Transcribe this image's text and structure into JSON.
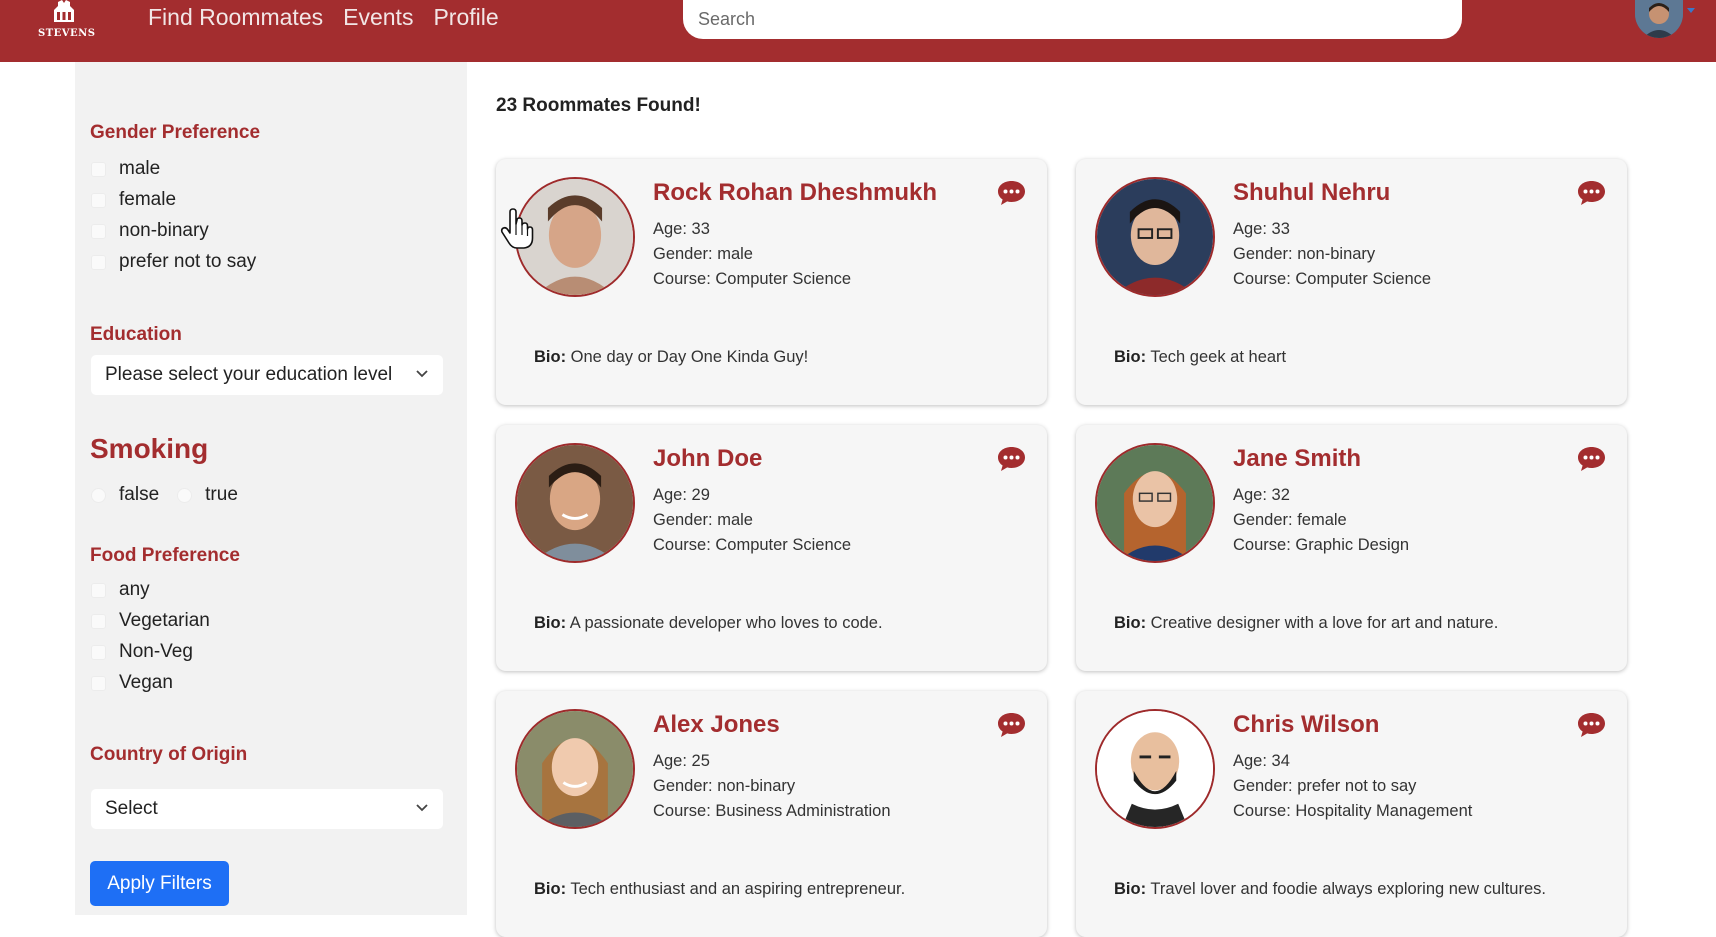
{
  "header": {
    "logo_text": "STEVENS",
    "nav": [
      "Find Roommates",
      "Events",
      "Profile"
    ],
    "search_placeholder": "Search",
    "brand_color": "#a32d2f"
  },
  "filters": {
    "gender": {
      "title": "Gender Preference",
      "options": [
        "male",
        "female",
        "non-binary",
        "prefer not to say"
      ]
    },
    "education": {
      "title": "Education",
      "selected": "Please select your education level"
    },
    "smoking": {
      "title": "Smoking",
      "options": [
        "false",
        "true"
      ]
    },
    "food": {
      "title": "Food Preference",
      "options": [
        "any",
        "Vegetarian",
        "Non-Veg",
        "Vegan"
      ]
    },
    "country": {
      "title": "Country of Origin",
      "selected": "Select"
    },
    "apply_label": "Apply Filters"
  },
  "results": {
    "count_text": "23 Roommates Found!",
    "bio_label": "Bio:",
    "cards": [
      {
        "name": "Rock Rohan Dheshmukh",
        "age": "Age: 33",
        "gender": "Gender: male",
        "course": "Course: Computer Science",
        "bio": "One day or Day One Kinda Guy!"
      },
      {
        "name": "Shuhul Nehru",
        "age": "Age: 33",
        "gender": "Gender: non-binary",
        "course": "Course: Computer Science",
        "bio": "Tech geek at heart"
      },
      {
        "name": "John Doe",
        "age": "Age: 29",
        "gender": "Gender: male",
        "course": "Course: Computer Science",
        "bio": "A passionate developer who loves to code."
      },
      {
        "name": "Jane Smith",
        "age": "Age: 32",
        "gender": "Gender: female",
        "course": "Course: Graphic Design",
        "bio": "Creative designer with a love for art and nature."
      },
      {
        "name": "Alex Jones",
        "age": "Age: 25",
        "gender": "Gender: non-binary",
        "course": "Course: Business Administration",
        "bio": "Tech enthusiast and an aspiring entrepreneur."
      },
      {
        "name": "Chris Wilson",
        "age": "Age: 34",
        "gender": "Gender: prefer not to say",
        "course": "Course: Hospitality Management",
        "bio": "Travel lover and foodie always exploring new cultures."
      }
    ]
  },
  "icons": {
    "chat": "chat-bubble-icon",
    "chevron": "chevron-down-icon",
    "logo": "stevens-logo-icon",
    "cursor": "hand-pointer-icon"
  }
}
